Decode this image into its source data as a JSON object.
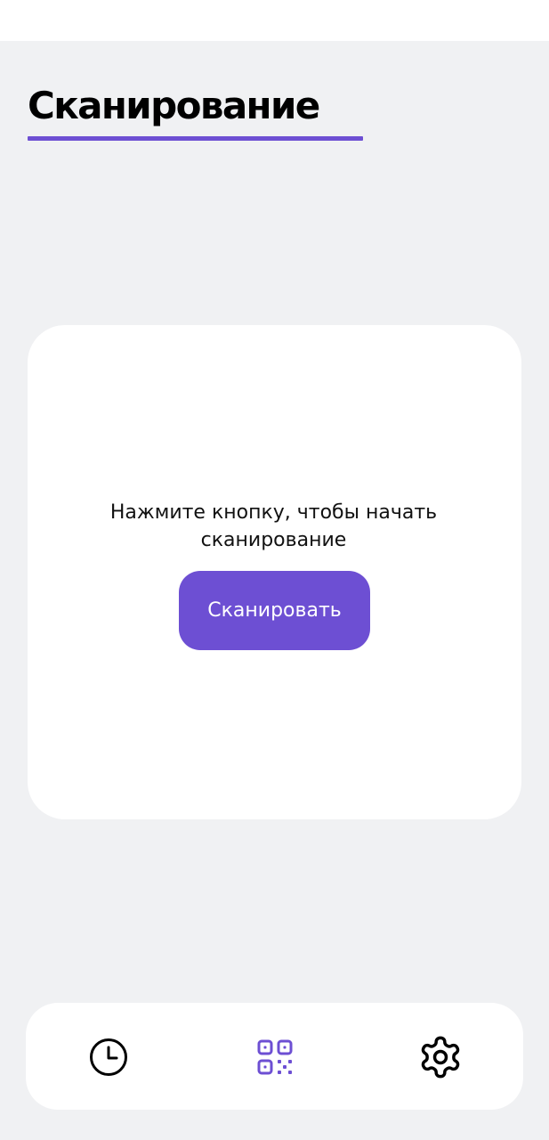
{
  "header": {
    "title": "Сканирование"
  },
  "scan_card": {
    "prompt": "Нажмите кнопку, чтобы начать сканирование",
    "button_label": "Сканировать"
  },
  "bottom_nav": {
    "items": [
      {
        "icon": "clock-icon",
        "active": false
      },
      {
        "icon": "qr-code-icon",
        "active": true
      },
      {
        "icon": "gear-icon",
        "active": false
      }
    ]
  },
  "colors": {
    "accent": "#6d4fd3",
    "background": "#f0f1f3",
    "surface": "#ffffff",
    "text": "#000000"
  }
}
